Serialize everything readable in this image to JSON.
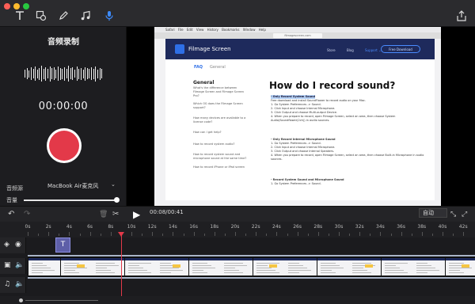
{
  "window": {
    "traffic_lights": [
      "#ff5f57",
      "#febc2e",
      "#28c840"
    ]
  },
  "toolbar": {
    "tools": [
      {
        "name": "text-tool",
        "icon": "text-icon",
        "glyph": "T"
      },
      {
        "name": "shape-tool",
        "icon": "shape-icon",
        "glyph": "◫"
      },
      {
        "name": "pen-tool",
        "icon": "pen-icon",
        "glyph": "✎"
      },
      {
        "name": "music-tool",
        "icon": "music-icon",
        "glyph": "♫"
      },
      {
        "name": "mic-tool",
        "icon": "mic-icon",
        "glyph": "🎙"
      }
    ],
    "active_tool": "mic-tool",
    "accent": "#3d8bfd"
  },
  "left_panel": {
    "title": "音频录制",
    "timer": "00:00:00",
    "record_color": "#e33949",
    "source_label": "音频源",
    "source_value": "MacBook Air麦克风",
    "volume_label": "音量",
    "volume_level": 0.97
  },
  "preview": {
    "menubar": "Safari  File  Edit  View  History  Bookmarks  Window  Help",
    "url": "filmagescreen.com",
    "site_name": "Filmage Screen",
    "nav": [
      "Store",
      "Blog",
      "Support ⌄"
    ],
    "download": "Free Download",
    "crumb_faq": "FAQ",
    "crumb_general": "General",
    "side_title": "General",
    "side_links": [
      "What's the difference between Filmage Screen and Filmage Screen Pro?",
      "Which OS does the Filmage Screen support?",
      "How many devices are available to a license code?",
      "How can I get help?",
      "How to record system audio?",
      "How to record system sound and microphone sound at the same time?",
      "How to record iPhone or iPad screen"
    ],
    "main_title": "How do I record sound?",
    "paragraphs": [
      "- Only Record System Sound",
      "Free download and install SoundFlower to record audio on your Mac.",
      "1. Go System Preferences -> Sound.",
      "2. Click Input and choose Internal Microphone.",
      "3. Click Output and choose Multi-output Device.",
      "4. When you prepare to record, open Filmage Screen, select an area, then choose System Audio(Soundflower(2ch)) in audio sources.",
      "- Only Record Internal Microphone Sound",
      "1. Go System Preferences -> Sound.",
      "2. Click Input and choose Internal Microphone.",
      "3. Click Output and choose Internal Speakers.",
      "4. When you prepare to record, open Filmage Screen, select an area, then choose Built-in Microphone in audio sources.",
      "- Record System Sound and Microphone Sound",
      "1. Go System Preferences -> Sound."
    ]
  },
  "controls": {
    "timecode": "00:08/00:41",
    "zoom": "自动"
  },
  "timeline": {
    "ticks": [
      "0s",
      "2s",
      "4s",
      "6s",
      "8s",
      "10s",
      "12s",
      "14s",
      "16s",
      "18s",
      "20s",
      "22s",
      "24s",
      "26s",
      "28s",
      "30s",
      "32s",
      "34s",
      "36s",
      "38s",
      "40s",
      "42s"
    ],
    "text_clip": "T",
    "playhead": "8s"
  }
}
